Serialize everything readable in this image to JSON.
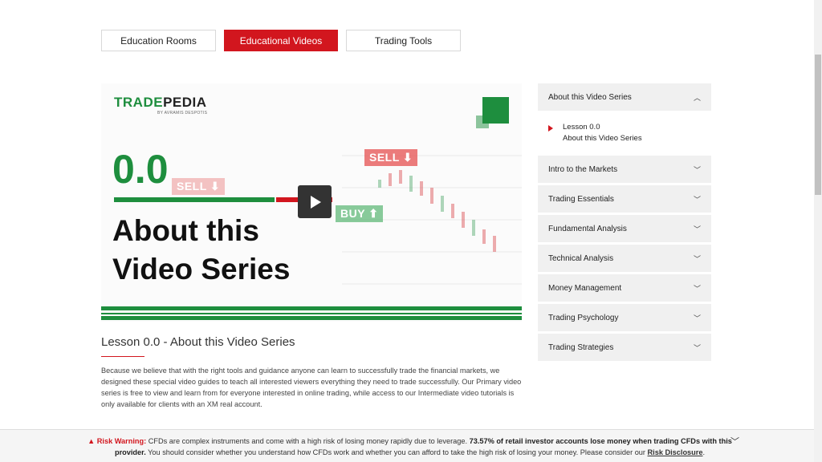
{
  "tabs": [
    {
      "label": "Education Rooms",
      "active": false
    },
    {
      "label": "Educational Videos",
      "active": true
    },
    {
      "label": "Trading Tools",
      "active": false
    }
  ],
  "video": {
    "brand_trade": "TRADE",
    "brand_pedia": "PEDIA",
    "brand_sub": "BY AVRAMIS DESPOTIS",
    "lesson_number": "0.0",
    "title_line1": "About this",
    "title_line2": "Video Series",
    "tag_sell": "SELL",
    "tag_buy": "BUY",
    "play_icon": "play-icon"
  },
  "lesson": {
    "heading": "Lesson 0.0 - About this Video Series",
    "body": "Because we believe that with the right tools and guidance anyone can learn to successfully trade the financial markets, we designed these special video guides to teach all interested viewers everything they need to trade successfully. Our Primary video series is free to view and learn from for everyone interested in online trading, while access to our Intermediate video tutorials is only available for clients with an XM real account."
  },
  "sidebar": {
    "expanded": {
      "label": "About this Video Series",
      "items": [
        {
          "line1": "Lesson 0.0",
          "line2": "About this Video Series"
        }
      ]
    },
    "sections": [
      {
        "label": "Intro to the Markets"
      },
      {
        "label": "Trading Essentials"
      },
      {
        "label": "Fundamental Analysis"
      },
      {
        "label": "Technical Analysis"
      },
      {
        "label": "Money Management"
      },
      {
        "label": "Trading Psychology"
      },
      {
        "label": "Trading Strategies"
      }
    ]
  },
  "risk": {
    "warning_label": "Risk Warning:",
    "text1": " CFDs are complex instruments and come with a high risk of losing money rapidly due to leverage. ",
    "bold_text": "73.57% of retail investor accounts lose money when trading CFDs with this provider.",
    "text2": " You should consider whether you understand how CFDs work and whether you can afford to take the high risk of losing your money. Please consider our ",
    "link": "Risk Disclosure",
    "end": "."
  },
  "colors": {
    "accent_red": "#d2161e",
    "brand_green": "#1e8e3e"
  }
}
